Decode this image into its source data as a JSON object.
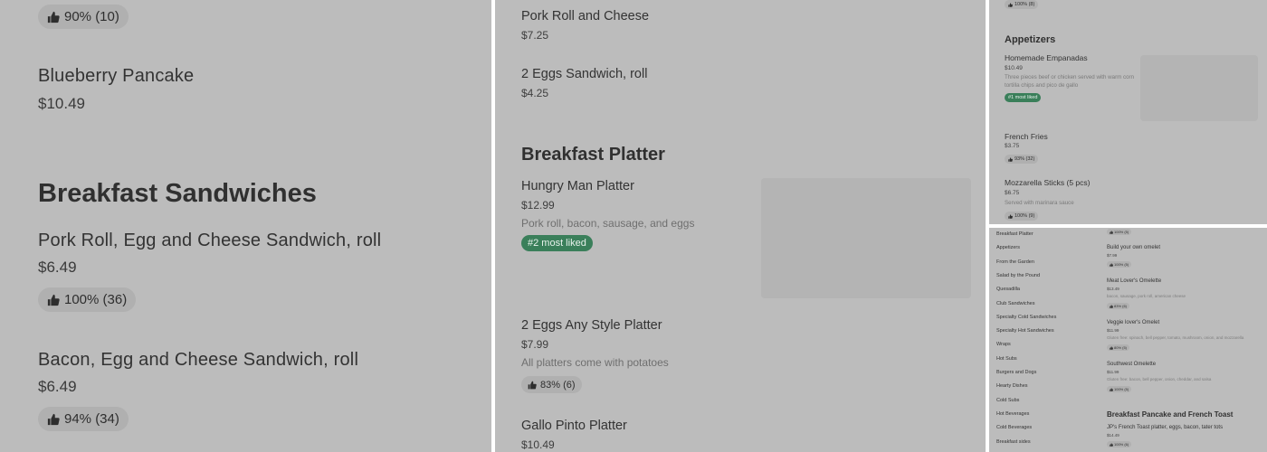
{
  "panel_a": {
    "top_rating": "90% (10)",
    "item1": {
      "name": "Blueberry Pancake",
      "price": "$10.49"
    },
    "section": "Breakfast Sandwiches",
    "item2": {
      "name": "Pork Roll, Egg and Cheese Sandwich, roll",
      "price": "$6.49",
      "rating": "100% (36)"
    },
    "item3": {
      "name": "Bacon, Egg and Cheese Sandwich, roll",
      "price": "$6.49",
      "rating": "94% (34)"
    }
  },
  "panel_b": {
    "item1": {
      "name": "Pork Roll and Cheese",
      "price": "$7.25"
    },
    "item2": {
      "name": "2 Eggs Sandwich, roll",
      "price": "$4.25"
    },
    "section": "Breakfast Platter",
    "item3": {
      "name": "Hungry Man Platter",
      "price": "$12.99",
      "desc": "Pork roll, bacon, sausage, and eggs",
      "tag": "#2 most liked"
    },
    "item4": {
      "name": "2 Eggs Any Style Platter",
      "price": "$7.99",
      "desc": "All platters come with potatoes",
      "rating": "83% (6)"
    },
    "item5": {
      "name": "Gallo Pinto Platter",
      "price": "$10.49"
    }
  },
  "panel_c": {
    "top_rating": "100% (8)",
    "section": "Appetizers",
    "item1": {
      "name": "Homemade Empanadas",
      "price": "$10.49",
      "desc": "Three pieces beef or chicken served with warm corn tortilla chips and pico de gallo",
      "tag": "#1 most liked"
    },
    "item2": {
      "name": "French Fries",
      "price": "$3.75",
      "rating": "93% (32)"
    },
    "item3": {
      "name": "Mozzarella Sticks (5 pcs)",
      "price": "$6.75",
      "desc": "Served with marinara sauce",
      "rating": "100% (9)"
    }
  },
  "panel_d": {
    "nav": [
      "Breakfast Platter",
      "Appetizers",
      "From the Garden",
      "Salad by the Pound",
      "Quesadilla",
      "Club Sandwiches",
      "Specialty Cold Sandwiches",
      "Specialty Hot Sandwiches",
      "Wraps",
      "Hot Subs",
      "Burgers and Dogs",
      "Hearty Dishes",
      "Cold Subs",
      "Hot Beverages",
      "Cold Beverages",
      "Breakfast sides"
    ],
    "top_rating": "100% (5)",
    "item1": {
      "name": "Build your own omelet",
      "price": "$7.99",
      "rating": "100% (5)"
    },
    "item2": {
      "name": "Meat Lover's Omelette",
      "price": "$13.49",
      "desc": "bacon, sausage, pork roll, american cheese",
      "rating": "83% (6)"
    },
    "item3": {
      "name": "Veggie lover's Omelet",
      "price": "$11.99",
      "desc": "Gluten free: spinach, bell pepper, tomato, mushroom, onion, and mozzarella",
      "rating": "80% (5)"
    },
    "item4": {
      "name": "Southwest Omelette",
      "price": "$11.99",
      "desc": "Gluten free: bacon, bell pepper, onion, cheddar, and salsa",
      "rating": "100% (5)"
    },
    "section": "Breakfast Pancake and French Toast",
    "item5": {
      "name": "JP's French Toast platter, eggs, bacon, tater tots",
      "price": "$14.49",
      "rating": "100% (6)"
    }
  }
}
